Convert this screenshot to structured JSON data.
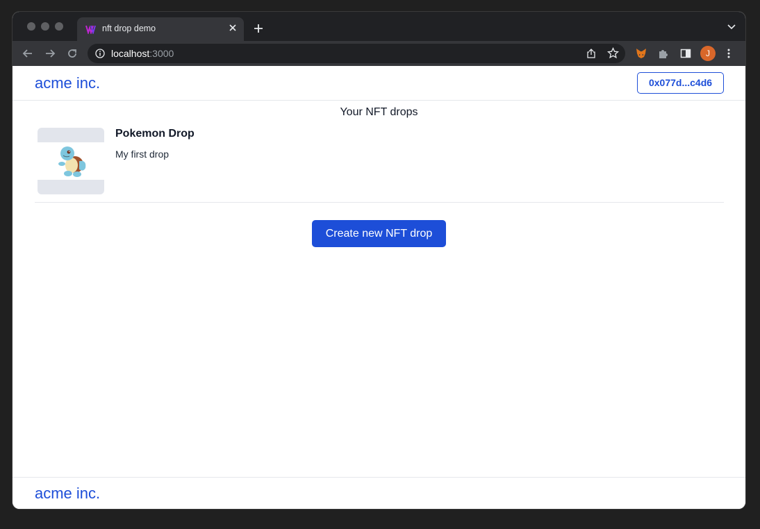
{
  "browser": {
    "tab_title": "nft drop demo",
    "url_host": "localhost",
    "url_port": ":3000",
    "profile_initial": "J"
  },
  "header": {
    "brand": "acme inc.",
    "wallet_address": "0x077d...c4d6"
  },
  "main": {
    "section_title": "Your NFT drops",
    "drops": [
      {
        "name": "Pokemon Drop",
        "description": "My first drop",
        "image_icon": "squirtle-image"
      }
    ],
    "create_button_label": "Create new NFT drop"
  },
  "footer": {
    "brand": "acme inc."
  },
  "colors": {
    "accent": "#1d4ed8",
    "browser_chrome": "#35363a",
    "tab_strip": "#202124"
  }
}
